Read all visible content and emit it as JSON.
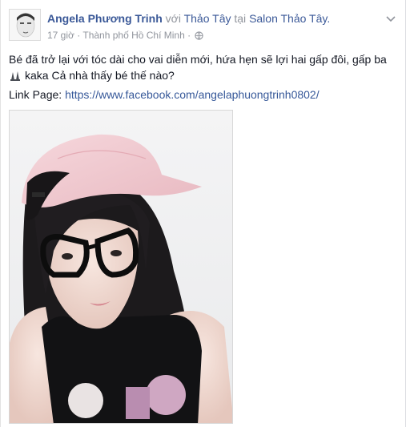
{
  "post": {
    "author": "Angela Phương Trinh",
    "with_word": "với",
    "tagged_friend": "Thảo Tây",
    "at_word": "tại",
    "place": "Salon Thảo Tây.",
    "time": "17 giờ",
    "separator": "·",
    "location": "Thành phố Hồ Chí Minh",
    "separator2": "·",
    "text_line1": "Bé đã trở lại với tóc dài cho vai diễn mới, hứa hẹn sẽ lợi hai gấp đôi, gấp ba",
    "text_line2": "kaka Cả nhà thấy bé thế nào?",
    "link_label": "Link Page:",
    "link_url": "https://www.facebook.com/angelaphuongtrinh0802/",
    "icons": {
      "options": "chevron-down-icon",
      "privacy": "globe-icon",
      "emoji": "rocket-emoji-icon"
    }
  }
}
